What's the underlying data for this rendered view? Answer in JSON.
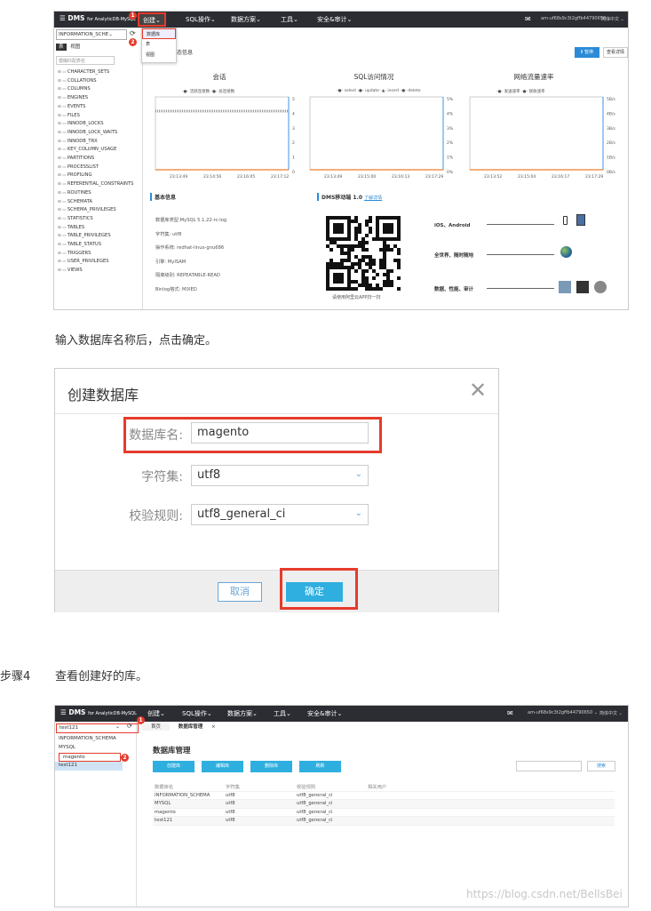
{
  "shot1": {
    "app": {
      "name": "DMS",
      "suffix": "for AnalyticDB-MySQL"
    },
    "menus": [
      "创建⌄",
      "SQL操作⌄",
      "数据方案⌄",
      "工具⌄",
      "安全&审计⌄"
    ],
    "badges": [
      "1",
      "2"
    ],
    "account": "am-uf68s9c3t2gffb44790650 ⌄",
    "language": "简体中文 ⌄",
    "db_selector": "INFORMATION_SCHE⌄",
    "side_tabs": [
      "表",
      "视图"
    ],
    "filter_placeholder": "模糊匹配表名",
    "tables": [
      "CHARACTER_SETS",
      "COLLATIONS",
      "COLUMNS",
      "ENGINES",
      "EVENTS",
      "FILES",
      "INNODB_LOCKS",
      "INNODB_LOCK_WAITS",
      "INNODB_TRX",
      "KEY_COLUMN_USAGE",
      "PARTITIONS",
      "PROCESSLIST",
      "PROFILING",
      "REFERENTIAL_CONSTRAINTS",
      "ROUTINES",
      "SCHEMATA",
      "SCHEMA_PRIVILEGES",
      "STATISTICS",
      "TABLES",
      "TABLE_PRIVILEGES",
      "TABLE_STATUS",
      "TRIGGERS",
      "USER_PRIVILEGES",
      "VIEWS"
    ],
    "dropdown": [
      "数据库",
      "表",
      "视图"
    ],
    "section_partial": "态信息",
    "btn_pause": "Ⅱ 暂停",
    "btn_detail": "查看详情",
    "charts": [
      {
        "title": "会话",
        "legend": "-●- 活跃连接数  -●- 总连接数",
        "y_ticks": [
          "5",
          "4",
          "3",
          "2",
          "1",
          "0"
        ],
        "x_ticks": [
          "23:13:49",
          "23:14:56",
          "23:16:05",
          "23:17:12"
        ]
      },
      {
        "title": "SQL访问情况",
        "legend": "-●- select  -●- update  -▲- insert  -●- delete",
        "y_ticks": [
          "5%",
          "4%",
          "3%",
          "2%",
          "1%",
          "0%"
        ],
        "x_ticks": [
          "23:13:49",
          "23:15:00",
          "23:16:13",
          "23:17:29"
        ]
      },
      {
        "title": "网络流量速率",
        "legend": "-●- 发送速率  -●- 接收速率",
        "y_ticks": [
          "5B/s",
          "4B/s",
          "3B/s",
          "2B/s",
          "1B/s",
          "0B/s"
        ],
        "x_ticks": [
          "23:13:52",
          "23:15:04",
          "23:16:17",
          "23:17:29"
        ]
      }
    ],
    "basic_info_title": "基本信息",
    "basic_info": [
      "数据库类型:MySQL 5.1.22-rc-log",
      "字符集: utf8",
      "操作系统: redhat-linux-gnu686",
      "引擎: MyISAM",
      "隔离级别: REPEATABLE-READ",
      "Binlog格式: MIXED"
    ],
    "mobile_title": "DMS移动端 1.0",
    "mobile_link": "了解详情",
    "qr_caption": "请使用阿里云APP扫一扫",
    "features": [
      "iOS、Android",
      "全世界、随时随地",
      "数据、性能、审计"
    ],
    "colors": {
      "orange": "#f07c2a",
      "blue": "#5aa6e8",
      "pink": "#e67ab9",
      "green": "#49b549",
      "accent": "#2b8bd8",
      "red": "#e53b2c"
    }
  },
  "caption1": "输入数据库名称后，点击确定。",
  "dialog": {
    "title": "创建数据库",
    "close": "✕",
    "fields": [
      {
        "label": "数据库名:",
        "value": "magento"
      },
      {
        "label": "字符集:",
        "value": "utf8"
      },
      {
        "label": "校验规则:",
        "value": "utf8_general_ci"
      }
    ],
    "chevron": "⌄",
    "cancel": "取消",
    "ok": "确定"
  },
  "step": {
    "label": "步骤4",
    "text": "查看创建好的库。"
  },
  "shot3": {
    "app": {
      "name": "DMS",
      "suffix": "for AnalyticDB-MySQL"
    },
    "menus": [
      "创建⌄",
      "SQL操作⌄",
      "数据方案⌄",
      "工具⌄",
      "安全&审计⌄"
    ],
    "account": "am-uf68s9c3t2gffb44790650 ⌄",
    "language": "简体中文 ⌄",
    "search_value": "test121",
    "badges": [
      "1",
      "2"
    ],
    "db_list": [
      "INFORMATION_SCHEMA",
      "MYSQL",
      "magento",
      "test121"
    ],
    "tabs": [
      "首页",
      "数据库管理",
      "×"
    ],
    "page_title": "数据库管理",
    "buttons": [
      "创建库",
      "编辑库",
      "删除库",
      "刷新"
    ],
    "search_btn": "搜索",
    "headers": [
      "数据库名",
      "字符集",
      "校验规则",
      "相关用户"
    ],
    "rows": [
      [
        "INFORMATION_SCHEMA",
        "utf8",
        "utf8_general_ci",
        ""
      ],
      [
        "MYSQL",
        "utf8",
        "utf8_general_ci",
        ""
      ],
      [
        "magento",
        "utf8",
        "utf8_general_ci",
        ""
      ],
      [
        "test121",
        "utf8",
        "utf8_general_ci",
        ""
      ]
    ]
  },
  "watermark": "https://blog.csdn.net/BellsBei"
}
